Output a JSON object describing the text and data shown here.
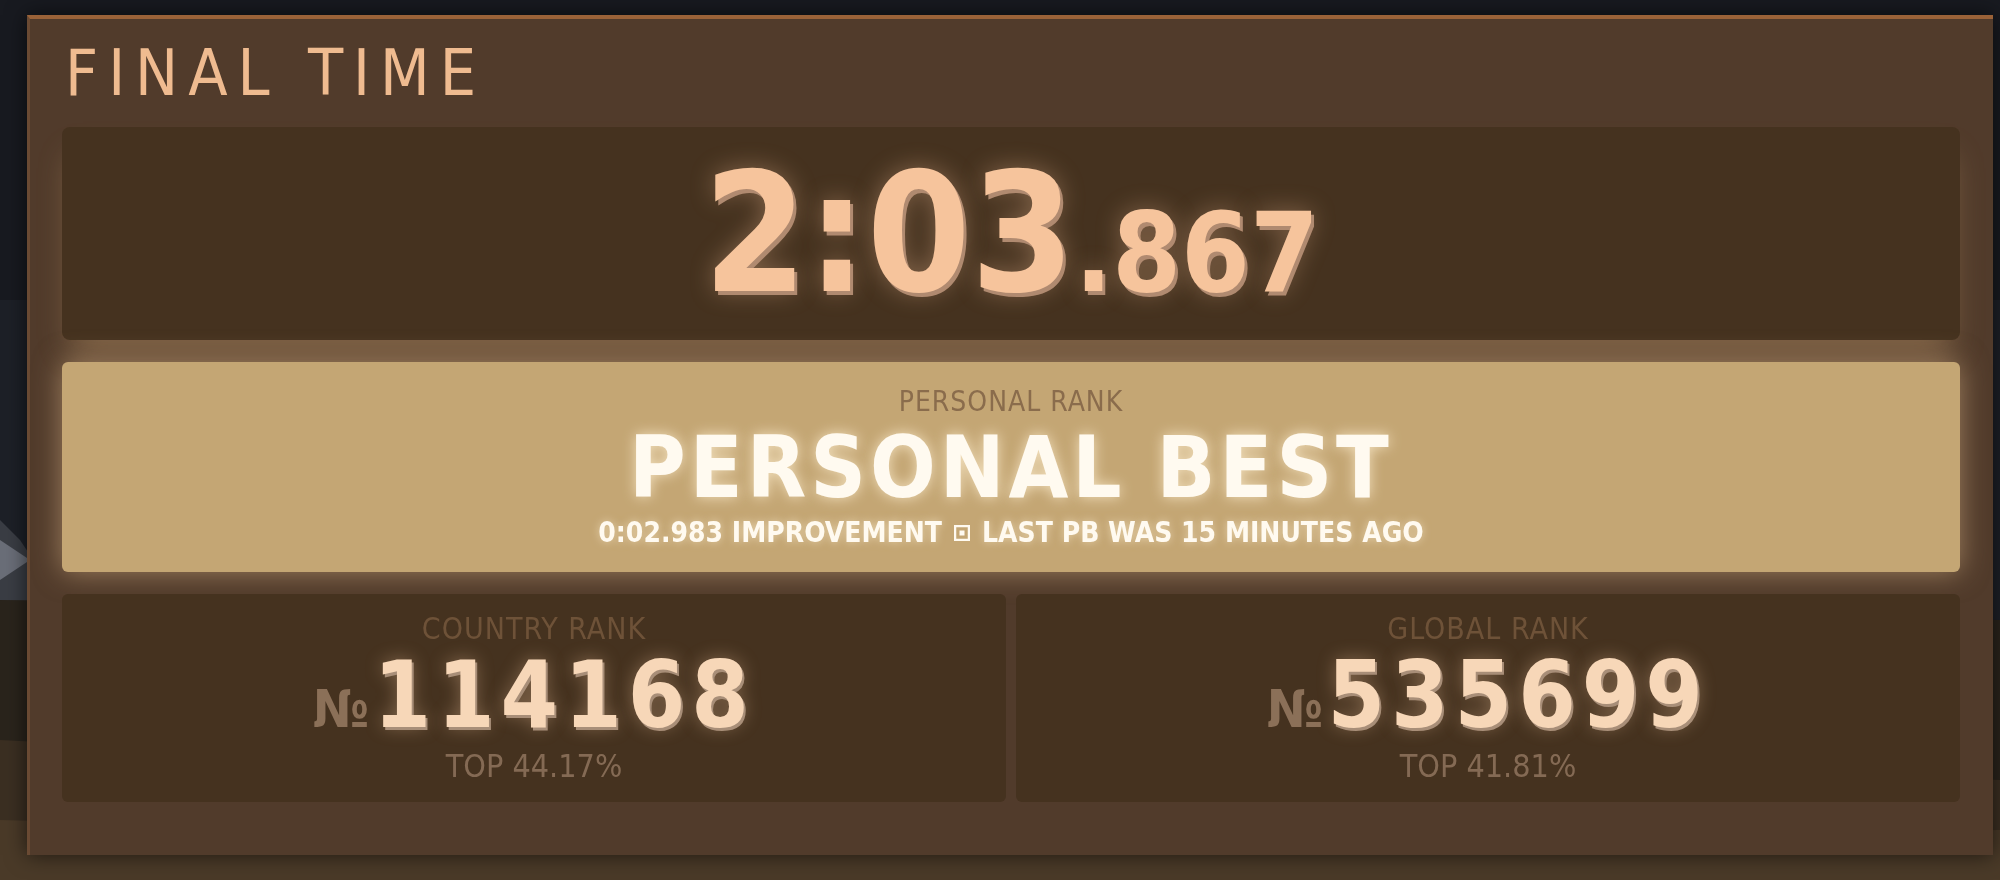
{
  "title": "FINAL TIME",
  "final_time": {
    "main": "2:03",
    "fraction": ".867"
  },
  "personal_rank": {
    "label": "PERSONAL RANK",
    "value": "PERSONAL BEST",
    "detail_parts": [
      "0:02.983 IMPROVEMENT",
      "LAST PB WAS 15 MINUTES AGO"
    ]
  },
  "ranks": [
    {
      "label": "COUNTRY RANK",
      "prefix": "№",
      "number": "114168",
      "top": "TOP 44.17%"
    },
    {
      "label": "GLOBAL RANK",
      "prefix": "№",
      "number": "535699",
      "top": "TOP 41.81%"
    }
  ]
}
